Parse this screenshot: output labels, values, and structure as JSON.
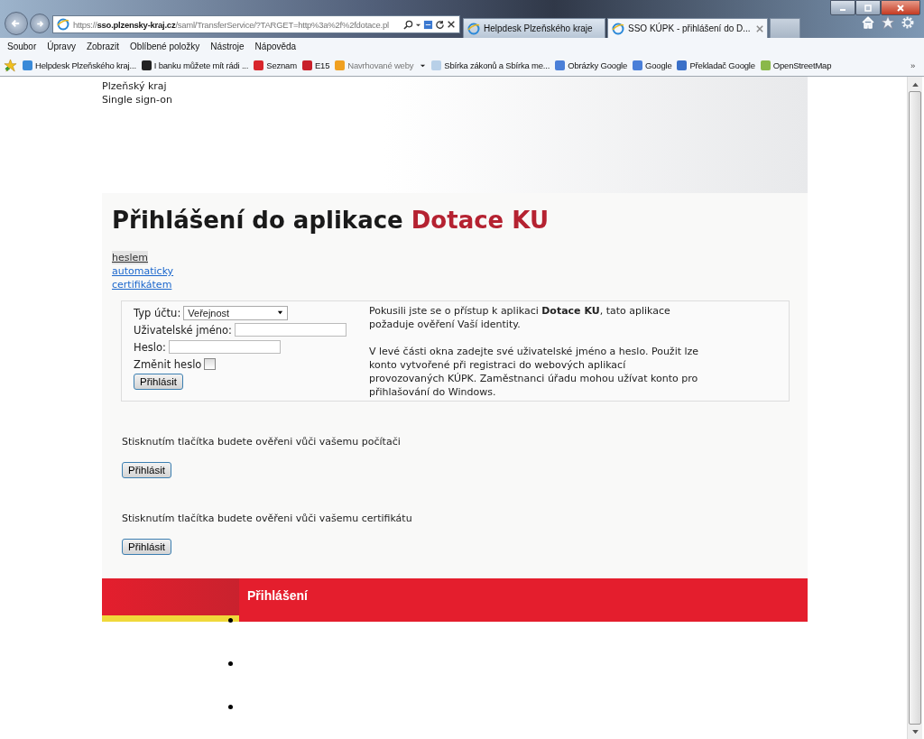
{
  "browser": {
    "address_host": "sso.plzensky-kraj.cz",
    "address_prefix": "https://",
    "address_path": "/saml/TransferService/?TARGET=http%3a%2f%2fdotace.pl",
    "tabs": [
      {
        "title": "Helpdesk Plzeňského kraje",
        "selected": false
      },
      {
        "title": "SSO KÚPK - přihlášení do D...",
        "selected": true
      }
    ],
    "menu": [
      "Soubor",
      "Úpravy",
      "Zobrazit",
      "Oblíbené položky",
      "Nástroje",
      "Nápověda"
    ],
    "favorites": [
      {
        "label": "Helpdesk Plzeňského kraj...",
        "color": "#3a8ad8",
        "has_menu": false
      },
      {
        "label": "I banku můžete mít rádi ...",
        "color": "#222222",
        "has_menu": false
      },
      {
        "label": "Seznam",
        "color": "#d8262c",
        "has_menu": false
      },
      {
        "label": "E15",
        "color": "#c8202a",
        "has_menu": false
      },
      {
        "label": "Navrhované weby",
        "color": "#f0a020",
        "has_menu": true
      },
      {
        "label": "Sbírka zákonů a Sbírka me...",
        "color": "#b8d0e8",
        "has_menu": false
      },
      {
        "label": "Obrázky Google",
        "color": "#4a7fd8",
        "has_menu": false
      },
      {
        "label": "Google",
        "color": "#4a7fd8",
        "has_menu": false
      },
      {
        "label": "Překladač Google",
        "color": "#3a70c8",
        "has_menu": false
      },
      {
        "label": "OpenStreetMap",
        "color": "#8ab84a",
        "has_menu": false
      }
    ],
    "more": "»"
  },
  "page": {
    "header_lines": [
      "Plzeňský kraj",
      "Single sign-on"
    ],
    "title": "Přihlášení do aplikace",
    "title_highlight": "Dotace KU",
    "methods": [
      {
        "label": "heslem",
        "selected": true
      },
      {
        "label": "automaticky",
        "selected": false
      },
      {
        "label": "certifikátem",
        "selected": false
      }
    ],
    "form": {
      "account_type_label": "Typ účtu:",
      "account_type": "Veřejnost",
      "username_label": "Uživatelské jméno:",
      "password_label": "Heslo:",
      "change_password_label": "Změnit heslo",
      "change_password": false,
      "button": "Přihlásit"
    },
    "info": [
      "Pokusili jste se o přístup k aplikaci **Dotace KU**, tato aplikace požaduje ověření Vaší identity.",
      "V levé části okna zadejte své uživatelské jméno a heslo. Použit lze konto vytvořené při registraci do webových aplikací provozovaných KÚPK. Zaměstnanci úřadu mohou užívat konto pro přihlašování do Windows."
    ],
    "sections": [
      {
        "text": "Stisknutím tlačítka budete ověřeni vůči vašemu počítači",
        "button": "Přihlásit"
      },
      {
        "text": "Stisknutím tlačítka budete ověřeni vůči vašemu certifikátu",
        "button": "Přihlásit"
      }
    ],
    "footer_title": "Přihlášení"
  }
}
